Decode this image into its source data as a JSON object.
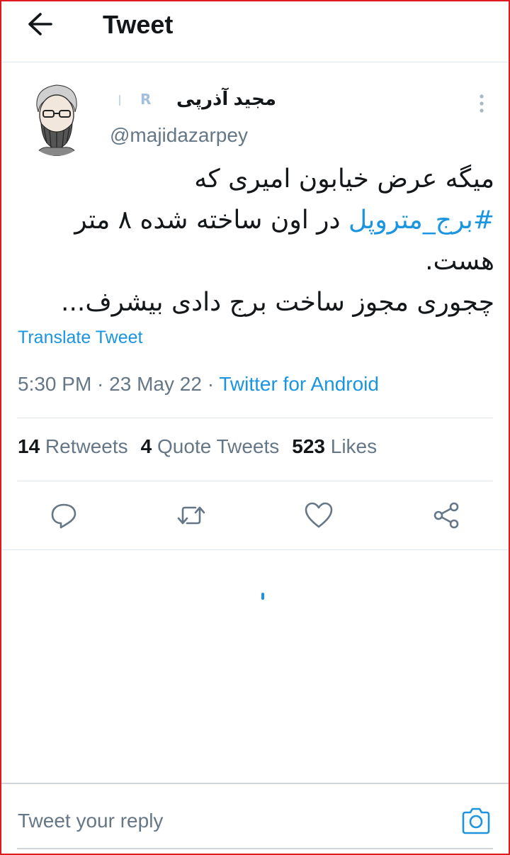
{
  "header": {
    "title": "Tweet",
    "back_icon": "arrow-left-icon"
  },
  "author": {
    "display_name": "مجید آذرپی",
    "badges": [
      "I",
      "R"
    ],
    "handle": "@majidazarpey"
  },
  "tweet": {
    "line1": "میگه عرض خیابون امیری که",
    "hashtag": "#برج_متروپل",
    "line2_rest": " در اون ساخته شده ۸ متر",
    "line3": "هست.",
    "line4": "چجوری مجوز ساخت برج دادی بیشرف..."
  },
  "translate_label": "Translate Tweet",
  "meta": {
    "time": "5:30 PM",
    "separator": " · ",
    "date": "23 May 22",
    "source": "Twitter for Android"
  },
  "stats": {
    "retweets_count": "14",
    "retweets_label": " Retweets",
    "quotes_count": "4",
    "quotes_label": " Quote Tweets",
    "likes_count": "523",
    "likes_label": " Likes"
  },
  "reply": {
    "placeholder": "Tweet your reply"
  },
  "colors": {
    "accent": "#1b95e0",
    "text": "#14171a",
    "muted": "#657786",
    "border": "#e1e8ed",
    "frame": "#e0191f"
  }
}
